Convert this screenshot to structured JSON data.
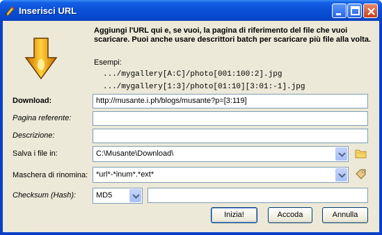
{
  "window": {
    "title": "Inserisci URL"
  },
  "intro_text": "Aggiungi l'URL qui e, se vuoi, la pagina di riferimento del file che vuoi scaricare. Puoi anche usare descrittori batch per scaricare più file alla volta.",
  "examples": {
    "label": "Esempi:",
    "items": [
      ".../mygallery[A:C]/photo[001:100:2].jpg",
      ".../mygallery[1:3]/photo[01:10][3:01:-1].jpg"
    ]
  },
  "fields": {
    "download": {
      "label": "Download:",
      "value": "http://musante.i.ph/blogs/musante?p=[3:119]"
    },
    "referer": {
      "label": "Pagina referente:",
      "value": ""
    },
    "description": {
      "label": "Descrizione:",
      "value": ""
    },
    "save_to": {
      "label": "Salva i file in:",
      "value": "C:\\Musante\\Download\\"
    },
    "rename_mask": {
      "label": "Maschera di rinomina:",
      "value": "*url*-*inum*.*ext*"
    },
    "checksum": {
      "label": "Checksum (Hash):",
      "type": "MD5",
      "value": ""
    }
  },
  "buttons": {
    "start": "Inizia!",
    "queue": "Accoda",
    "cancel": "Annulla"
  },
  "icons": {
    "title": "pencil-icon",
    "arrow": "download-arrow-icon",
    "folder": "folder-icon",
    "tag": "tag-icon"
  }
}
